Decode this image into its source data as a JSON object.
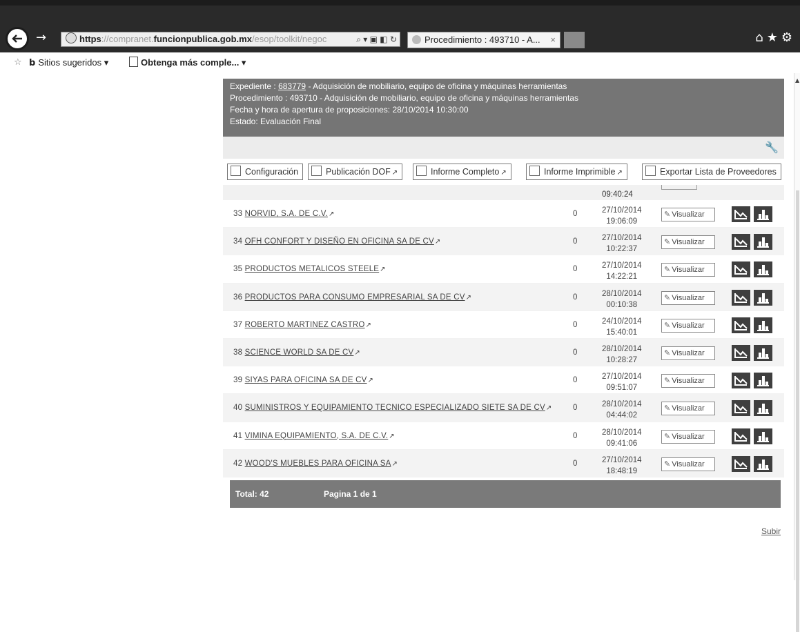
{
  "browser": {
    "url_protocol": "https",
    "url_pre": "://compranet.",
    "url_domain": "funcionpublica.gob.mx",
    "url_post": "/esop/toolkit/negoc",
    "tab_title": "Procedimiento : 493710 - A...",
    "tab_close": "×"
  },
  "favorites": {
    "suggested": "Sitios sugeridos ▾",
    "get_more": "Obtenga más comple... ▾"
  },
  "header": {
    "expediente_label": "Expediente : ",
    "expediente_id": "683779",
    "expediente_desc": " - Adquisición de mobiliario, equipo de oficina y máquinas herramientas",
    "procedimiento": "Procedimiento : 493710 - Adquisición de mobiliario, equipo de oficina y máquinas herramientas",
    "fecha": "Fecha y hora de apertura de proposiciones: 28/10/2014 10:30:00",
    "estado": "Estado: Evaluación Final"
  },
  "toolbar": {
    "config": "Configuración",
    "dof": "Publicación DOF",
    "informe_completo": "Informe Completo",
    "informe_imprimible": "Informe Imprimible",
    "exportar": "Exportar Lista de Proveedores"
  },
  "prev_time": "09:40:24",
  "rows": [
    {
      "num": "33",
      "name": "NORVID, S.A. DE C.V.",
      "count": "0",
      "date": "27/10/2014",
      "time": "19:06:09"
    },
    {
      "num": "34",
      "name": "OFH CONFORT Y DISEÑO EN OFICINA SA DE CV",
      "count": "0",
      "date": "27/10/2014",
      "time": "10:22:37"
    },
    {
      "num": "35",
      "name": "PRODUCTOS METALICOS STEELE",
      "count": "0",
      "date": "27/10/2014",
      "time": "14:22:21"
    },
    {
      "num": "36",
      "name": "PRODUCTOS PARA CONSUMO EMPRESARIAL SA DE CV",
      "count": "0",
      "date": "28/10/2014",
      "time": "00:10:38"
    },
    {
      "num": "37",
      "name": "ROBERTO MARTINEZ CASTRO",
      "count": "0",
      "date": "24/10/2014",
      "time": "15:40:01"
    },
    {
      "num": "38",
      "name": "SCIENCE WORLD SA DE CV",
      "count": "0",
      "date": "28/10/2014",
      "time": "10:28:27"
    },
    {
      "num": "39",
      "name": "SIYAS PARA OFICINA SA DE CV",
      "count": "0",
      "date": "27/10/2014",
      "time": "09:51:07"
    },
    {
      "num": "40",
      "name": "SUMINISTROS Y EQUIPAMIENTO TECNICO ESPECIALIZADO SIETE SA DE CV",
      "count": "0",
      "date": "28/10/2014",
      "time": "04:44:02"
    },
    {
      "num": "41",
      "name": "VIMINA EQUIPAMIENTO, S.A. DE C.V.",
      "count": "0",
      "date": "28/10/2014",
      "time": "09:41:06"
    },
    {
      "num": "42",
      "name": "WOOD'S MUEBLES PARA OFICINA SA",
      "count": "0",
      "date": "27/10/2014",
      "time": "18:48:19"
    }
  ],
  "visualizar_label": "Visualizar",
  "footer": {
    "total": "Total: 42",
    "page": "Pagina 1 de 1"
  },
  "subir": "Subir"
}
